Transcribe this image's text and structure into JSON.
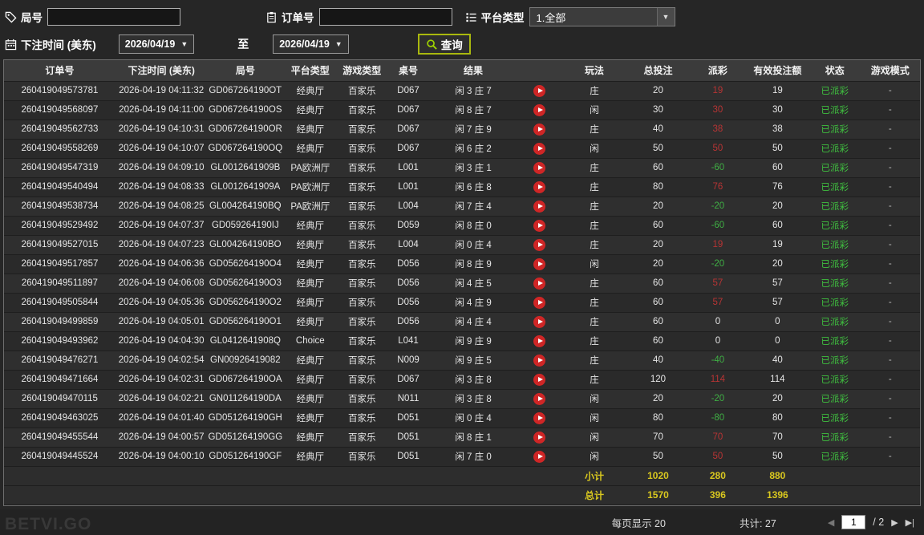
{
  "watermark": "BETVI.GO",
  "toolbar": {
    "round_label": "局号",
    "round_value": "",
    "order_label": "订单号",
    "order_value": "",
    "platform_label": "平台类型",
    "platform_value": "1.全部",
    "bet_time_label": "下注时间 (美东)",
    "date_from": "2026/04/19",
    "to_label": "至",
    "date_to": "2026/04/19",
    "search_label": "查询"
  },
  "table": {
    "headers": [
      "订单号",
      "下注时间 (美东)",
      "局号",
      "平台类型",
      "游戏类型",
      "桌号",
      "结果",
      "",
      "玩法",
      "总投注",
      "派彩",
      "有效投注额",
      "状态",
      "游戏模式"
    ],
    "rows": [
      {
        "order": "260419049573781",
        "time": "2026-04-19 04:11:32",
        "round": "GD067264190OT",
        "platform": "经典厅",
        "game": "百家乐",
        "table": "D067",
        "result": "闲 3 庄 7",
        "play": "庄",
        "total": "20",
        "payout": "19",
        "valid": "19",
        "status": "已派彩",
        "mode": "-"
      },
      {
        "order": "260419049568097",
        "time": "2026-04-19 04:11:00",
        "round": "GD067264190OS",
        "platform": "经典厅",
        "game": "百家乐",
        "table": "D067",
        "result": "闲 8 庄 7",
        "play": "闲",
        "total": "30",
        "payout": "30",
        "valid": "30",
        "status": "已派彩",
        "mode": "-"
      },
      {
        "order": "260419049562733",
        "time": "2026-04-19 04:10:31",
        "round": "GD067264190OR",
        "platform": "经典厅",
        "game": "百家乐",
        "table": "D067",
        "result": "闲 7 庄 9",
        "play": "庄",
        "total": "40",
        "payout": "38",
        "valid": "38",
        "status": "已派彩",
        "mode": "-"
      },
      {
        "order": "260419049558269",
        "time": "2026-04-19 04:10:07",
        "round": "GD067264190OQ",
        "platform": "经典厅",
        "game": "百家乐",
        "table": "D067",
        "result": "闲 6 庄 2",
        "play": "闲",
        "total": "50",
        "payout": "50",
        "valid": "50",
        "status": "已派彩",
        "mode": "-"
      },
      {
        "order": "260419049547319",
        "time": "2026-04-19 04:09:10",
        "round": "GL0012641909B",
        "platform": "PA欧洲厅",
        "game": "百家乐",
        "table": "L001",
        "result": "闲 3 庄 1",
        "play": "庄",
        "total": "60",
        "payout": "-60",
        "valid": "60",
        "status": "已派彩",
        "mode": "-"
      },
      {
        "order": "260419049540494",
        "time": "2026-04-19 04:08:33",
        "round": "GL0012641909A",
        "platform": "PA欧洲厅",
        "game": "百家乐",
        "table": "L001",
        "result": "闲 6 庄 8",
        "play": "庄",
        "total": "80",
        "payout": "76",
        "valid": "76",
        "status": "已派彩",
        "mode": "-"
      },
      {
        "order": "260419049538734",
        "time": "2026-04-19 04:08:25",
        "round": "GL004264190BQ",
        "platform": "PA欧洲厅",
        "game": "百家乐",
        "table": "L004",
        "result": "闲 7 庄 4",
        "play": "庄",
        "total": "20",
        "payout": "-20",
        "valid": "20",
        "status": "已派彩",
        "mode": "-"
      },
      {
        "order": "260419049529492",
        "time": "2026-04-19 04:07:37",
        "round": "GD059264190IJ",
        "platform": "经典厅",
        "game": "百家乐",
        "table": "D059",
        "result": "闲 8 庄 0",
        "play": "庄",
        "total": "60",
        "payout": "-60",
        "valid": "60",
        "status": "已派彩",
        "mode": "-"
      },
      {
        "order": "260419049527015",
        "time": "2026-04-19 04:07:23",
        "round": "GL004264190BO",
        "platform": "经典厅",
        "game": "百家乐",
        "table": "L004",
        "result": "闲 0 庄 4",
        "play": "庄",
        "total": "20",
        "payout": "19",
        "valid": "19",
        "status": "已派彩",
        "mode": "-"
      },
      {
        "order": "260419049517857",
        "time": "2026-04-19 04:06:36",
        "round": "GD056264190O4",
        "platform": "经典厅",
        "game": "百家乐",
        "table": "D056",
        "result": "闲 8 庄 9",
        "play": "闲",
        "total": "20",
        "payout": "-20",
        "valid": "20",
        "status": "已派彩",
        "mode": "-"
      },
      {
        "order": "260419049511897",
        "time": "2026-04-19 04:06:08",
        "round": "GD056264190O3",
        "platform": "经典厅",
        "game": "百家乐",
        "table": "D056",
        "result": "闲 4 庄 5",
        "play": "庄",
        "total": "60",
        "payout": "57",
        "valid": "57",
        "status": "已派彩",
        "mode": "-"
      },
      {
        "order": "260419049505844",
        "time": "2026-04-19 04:05:36",
        "round": "GD056264190O2",
        "platform": "经典厅",
        "game": "百家乐",
        "table": "D056",
        "result": "闲 4 庄 9",
        "play": "庄",
        "total": "60",
        "payout": "57",
        "valid": "57",
        "status": "已派彩",
        "mode": "-"
      },
      {
        "order": "260419049499859",
        "time": "2026-04-19 04:05:01",
        "round": "GD056264190O1",
        "platform": "经典厅",
        "game": "百家乐",
        "table": "D056",
        "result": "闲 4 庄 4",
        "play": "庄",
        "total": "60",
        "payout": "0",
        "valid": "0",
        "status": "已派彩",
        "mode": "-"
      },
      {
        "order": "260419049493962",
        "time": "2026-04-19 04:04:30",
        "round": "GL0412641908Q",
        "platform": "Choice",
        "game": "百家乐",
        "table": "L041",
        "result": "闲 9 庄 9",
        "play": "庄",
        "total": "60",
        "payout": "0",
        "valid": "0",
        "status": "已派彩",
        "mode": "-"
      },
      {
        "order": "260419049476271",
        "time": "2026-04-19 04:02:54",
        "round": "GN00926419082",
        "platform": "经典厅",
        "game": "百家乐",
        "table": "N009",
        "result": "闲 9 庄 5",
        "play": "庄",
        "total": "40",
        "payout": "-40",
        "valid": "40",
        "status": "已派彩",
        "mode": "-"
      },
      {
        "order": "260419049471664",
        "time": "2026-04-19 04:02:31",
        "round": "GD067264190OA",
        "platform": "经典厅",
        "game": "百家乐",
        "table": "D067",
        "result": "闲 3 庄 8",
        "play": "庄",
        "total": "120",
        "payout": "114",
        "valid": "114",
        "status": "已派彩",
        "mode": "-"
      },
      {
        "order": "260419049470115",
        "time": "2026-04-19 04:02:21",
        "round": "GN011264190DA",
        "platform": "经典厅",
        "game": "百家乐",
        "table": "N011",
        "result": "闲 3 庄 8",
        "play": "闲",
        "total": "20",
        "payout": "-20",
        "valid": "20",
        "status": "已派彩",
        "mode": "-"
      },
      {
        "order": "260419049463025",
        "time": "2026-04-19 04:01:40",
        "round": "GD051264190GH",
        "platform": "经典厅",
        "game": "百家乐",
        "table": "D051",
        "result": "闲 0 庄 4",
        "play": "闲",
        "total": "80",
        "payout": "-80",
        "valid": "80",
        "status": "已派彩",
        "mode": "-"
      },
      {
        "order": "260419049455544",
        "time": "2026-04-19 04:00:57",
        "round": "GD051264190GG",
        "platform": "经典厅",
        "game": "百家乐",
        "table": "D051",
        "result": "闲 8 庄 1",
        "play": "闲",
        "total": "70",
        "payout": "70",
        "valid": "70",
        "status": "已派彩",
        "mode": "-"
      },
      {
        "order": "260419049445524",
        "time": "2026-04-19 04:00:10",
        "round": "GD051264190GF",
        "platform": "经典厅",
        "game": "百家乐",
        "table": "D051",
        "result": "闲 7 庄 0",
        "play": "闲",
        "total": "50",
        "payout": "50",
        "valid": "50",
        "status": "已派彩",
        "mode": "-"
      }
    ],
    "subtotal": {
      "label": "小计",
      "total": "1020",
      "payout": "280",
      "valid": "880"
    },
    "grand_total": {
      "label": "总计",
      "total": "1570",
      "payout": "396",
      "valid": "1396"
    }
  },
  "footer": {
    "per_page": "每页显示 20",
    "total_count": "共计: 27",
    "page": "1",
    "pages_suffix": "/ 2",
    "prev_icon": "◀",
    "next_icon": "▶",
    "last_icon": "▶|"
  },
  "colors": {
    "payout_win": "#b73434",
    "payout_loss": "#3fae44",
    "status_paid": "#3fbf3f",
    "summary": "#d9c81f",
    "search_border": "#a9b80e"
  }
}
